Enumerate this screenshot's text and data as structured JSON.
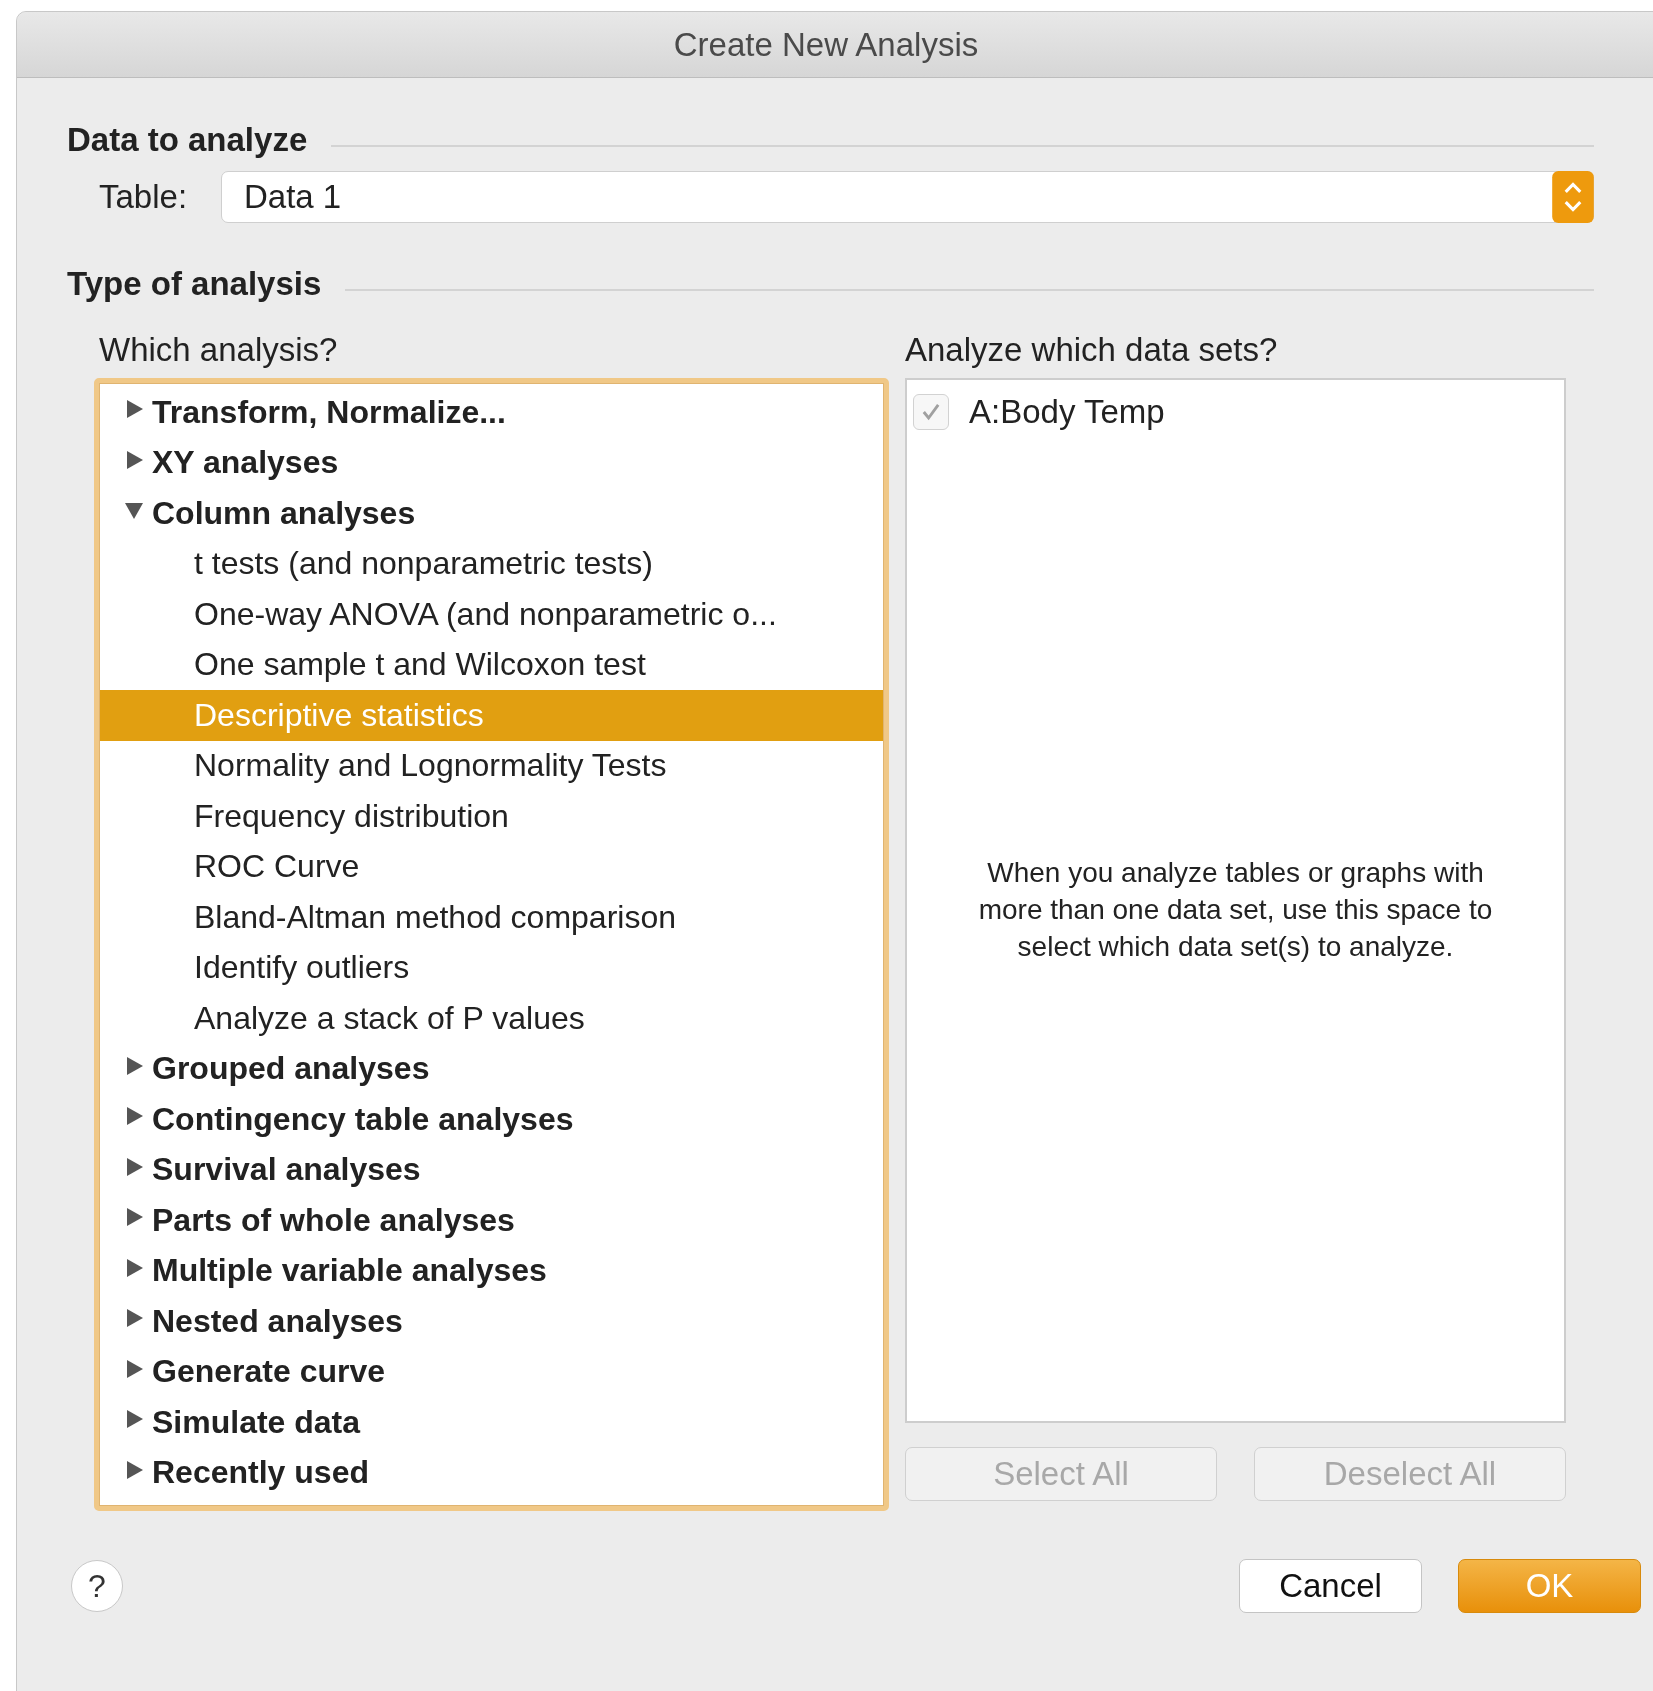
{
  "window": {
    "title": "Create New Analysis"
  },
  "data_section": {
    "heading": "Data to analyze",
    "table_label": "Table:",
    "table_value": "Data 1"
  },
  "type_section": {
    "heading": "Type of analysis",
    "left_label": "Which analysis?",
    "right_label": "Analyze which data sets?"
  },
  "analysis_tree": [
    {
      "label": "Transform, Normalize...",
      "expanded": false,
      "selected": false
    },
    {
      "label": "XY analyses",
      "expanded": false,
      "selected": false
    },
    {
      "label": "Column analyses",
      "expanded": true,
      "selected": false,
      "children": [
        {
          "label": "t tests (and nonparametric tests)",
          "selected": false
        },
        {
          "label": "One-way ANOVA (and nonparametric o...",
          "selected": false
        },
        {
          "label": "One sample t and Wilcoxon test",
          "selected": false
        },
        {
          "label": "Descriptive statistics",
          "selected": true
        },
        {
          "label": "Normality and Lognormality Tests",
          "selected": false
        },
        {
          "label": "Frequency distribution",
          "selected": false
        },
        {
          "label": "ROC Curve",
          "selected": false
        },
        {
          "label": "Bland-Altman method comparison",
          "selected": false
        },
        {
          "label": "Identify outliers",
          "selected": false
        },
        {
          "label": "Analyze a stack of P values",
          "selected": false
        }
      ]
    },
    {
      "label": "Grouped analyses",
      "expanded": false,
      "selected": false
    },
    {
      "label": "Contingency table analyses",
      "expanded": false,
      "selected": false
    },
    {
      "label": "Survival analyses",
      "expanded": false,
      "selected": false
    },
    {
      "label": "Parts of whole analyses",
      "expanded": false,
      "selected": false
    },
    {
      "label": "Multiple variable analyses",
      "expanded": false,
      "selected": false
    },
    {
      "label": "Nested analyses",
      "expanded": false,
      "selected": false
    },
    {
      "label": "Generate curve",
      "expanded": false,
      "selected": false
    },
    {
      "label": "Simulate data",
      "expanded": false,
      "selected": false
    },
    {
      "label": "Recently used",
      "expanded": false,
      "selected": false
    }
  ],
  "data_sets": [
    {
      "label": "A:Body Temp",
      "checked": true,
      "disabled": true
    }
  ],
  "data_sets_hint": "When you analyze tables or graphs with more than one data set, use this space to select which data set(s) to analyze.",
  "data_set_buttons": [
    {
      "label": "Select All",
      "disabled": true
    },
    {
      "label": "Deselect All",
      "disabled": true
    }
  ],
  "help_button": "?",
  "buttons": [
    {
      "label": "Cancel",
      "kind": "normal"
    },
    {
      "label": "OK",
      "kind": "default"
    }
  ]
}
